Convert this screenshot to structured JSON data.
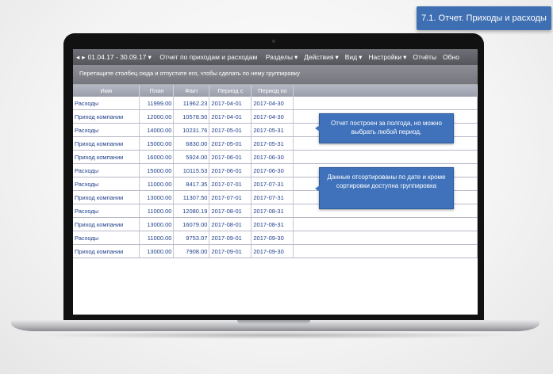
{
  "badge": "7.1. Отчет. Приходы и расходы",
  "toolbar": {
    "period": "01.04.17 - 30.09.17",
    "report_title": "Отчет по приходам и расходам",
    "menu": [
      "Разделы",
      "Действия",
      "Вид",
      "Настройки",
      "Отчёты",
      "Обно"
    ]
  },
  "group_hint": "Перетащите столбец сюда и отпустите его, чтобы сделать по нему группировку",
  "columns": [
    "Имя",
    "План",
    "Факт",
    "Период с",
    "Период по"
  ],
  "rows": [
    [
      "Расходы",
      "11999.00",
      "11962.23",
      "2017-04-01",
      "2017-04-30"
    ],
    [
      "Приход компании",
      "12000.00",
      "10578.50",
      "2017-04-01",
      "2017-04-30"
    ],
    [
      "Расходы",
      "14000.00",
      "10231.76",
      "2017-05-01",
      "2017-05-31"
    ],
    [
      "Приход компании",
      "15000.00",
      "6830.00",
      "2017-05-01",
      "2017-05-31"
    ],
    [
      "Приход компании",
      "16000.00",
      "5924.00",
      "2017-06-01",
      "2017-06-30"
    ],
    [
      "Расходы",
      "15000.00",
      "10115.53",
      "2017-06-01",
      "2017-06-30"
    ],
    [
      "Расходы",
      "11000.00",
      "8417.35",
      "2017-07-01",
      "2017-07-31"
    ],
    [
      "Приход компании",
      "13000.00",
      "11307.50",
      "2017-07-01",
      "2017-07-31"
    ],
    [
      "Расходы",
      "11000.00",
      "12080.19",
      "2017-08-01",
      "2017-08-31"
    ],
    [
      "Приход компании",
      "13000.00",
      "16079.00",
      "2017-08-01",
      "2017-08-31"
    ],
    [
      "Расходы",
      "11000.00",
      "9753.07",
      "2017-09-01",
      "2017-09-30"
    ],
    [
      "Приход компании",
      "13000.00",
      "7908.00",
      "2017-09-01",
      "2017-09-30"
    ]
  ],
  "tips": {
    "period_note": "Отчет построен за полгода, но можно выбрать любой период.",
    "sort_note": "Данные отсортированы по дате и кроме сортировки доступна группировка"
  },
  "colors": {
    "badge": "#3f6fb3",
    "link_text": "#1f3f8a",
    "tip": "#3f72bb"
  }
}
